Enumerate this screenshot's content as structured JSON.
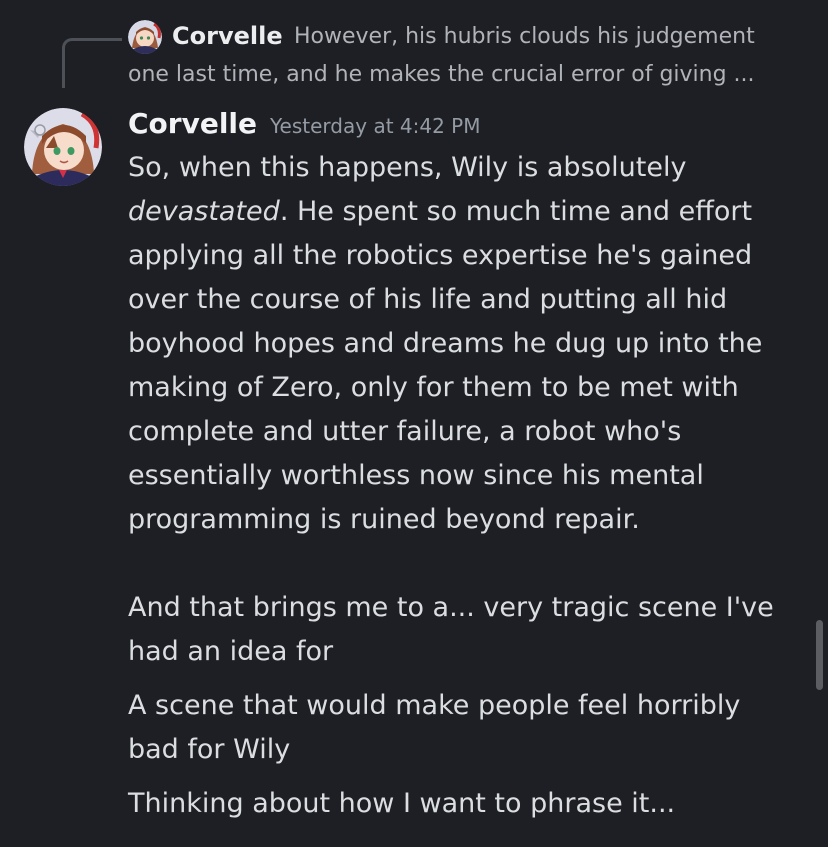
{
  "reply": {
    "author": "Corvelle",
    "preview_line_1": "However, his hubris clouds his judgement",
    "preview_line_2": "one last time, and he makes the crucial error of giving ..."
  },
  "message": {
    "author": "Corvelle",
    "timestamp": "Yesterday at 4:42 PM",
    "paragraph_1": {
      "line_1": "So, when this happens, Wily is absolutely",
      "line_2_italic": "devastated",
      "line_2_rest": ". He spent so much time and effort",
      "line_3": "applying all the robotics expertise he's gained",
      "line_4": "over the course of his life and putting all hid",
      "line_5": "boyhood hopes and dreams he dug up into the",
      "line_6": "making of Zero, only for them to be met with",
      "line_7": "complete and utter failure, a robot who's",
      "line_8": "essentially worthless now since his mental",
      "line_9": "programming is ruined beyond repair."
    },
    "paragraph_2": {
      "line_1": "And that brings me to a... very tragic scene I've",
      "line_2": "had an idea for"
    }
  },
  "followups": [
    {
      "line_1": "A scene that would make people feel horribly",
      "line_2": "bad for Wily"
    },
    {
      "line_1": "Thinking about how I want to phrase it..."
    }
  ],
  "icons": {
    "reply_avatar": "anime-avatar-icon",
    "author_avatar": "anime-avatar-icon"
  },
  "colors": {
    "background": "#1e1f24",
    "text": "#dbdee1",
    "muted": "#949ba4"
  }
}
